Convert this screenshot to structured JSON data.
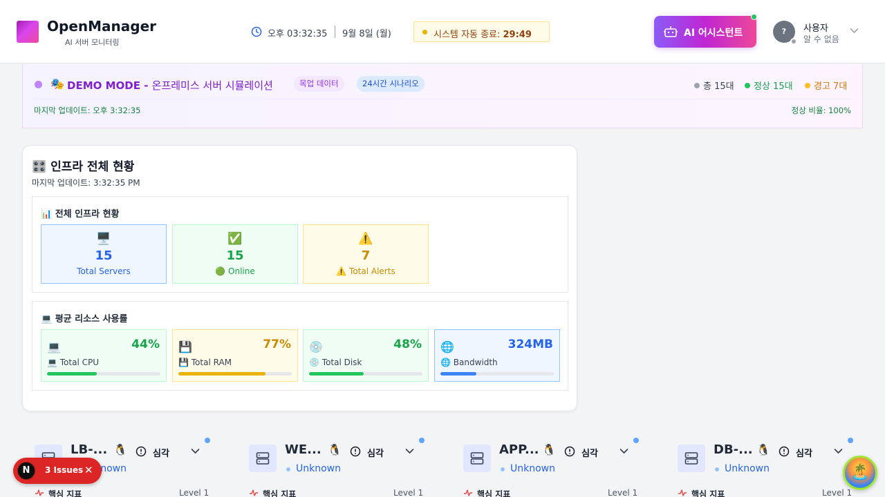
{
  "header": {
    "title": "OpenManager",
    "subtitle": "AI 서버 모니터링",
    "time": "오후 03:32:35",
    "date": "9월 8일 (월)",
    "shutdown_label": "시스템 자동 종료:",
    "shutdown_timer": "29:49",
    "ai_button_label": "AI 어시스턴트",
    "user_avatar_initial": "?",
    "user_name": "사용자",
    "user_status": "알 수 없음"
  },
  "demo_banner": {
    "emoji": "🎭",
    "title_bold": "DEMO MODE -",
    "title_rest": "온프레미스 서버 시뮬레이션",
    "tag_mock": "목업 데이터",
    "tag_scenario": "24시간 시나리오",
    "total": "총 15대",
    "normal": "정상 15대",
    "warning": "경고 7대",
    "last_updated": "마지막 업데이트: 오후 3:32:35",
    "normal_ratio": "정상 비율: 100%"
  },
  "infra": {
    "title": "🎛️ 인프라 전체 현황",
    "last_updated": "마지막 업데이트: 3:32:35 PM",
    "overview": {
      "title": "📊 전체 인프라 현황",
      "stats": [
        {
          "icon": "🖥️",
          "value": "15",
          "label": "Total Servers",
          "color": "#2563eb",
          "bg": "#eff6ff",
          "border": "#93c5fd"
        },
        {
          "icon": "✅",
          "value": "15",
          "label": "🟢 Online",
          "color": "#16a34a",
          "bg": "#f0fdf4",
          "border": "#bbf7d0"
        },
        {
          "icon": "⚠️",
          "value": "7",
          "label": "⚠️ Total Alerts",
          "color": "#ca8a04",
          "bg": "#fefce8",
          "border": "#fde68a"
        }
      ]
    },
    "resources": {
      "title": "💻 평균 리소스 사용률",
      "items": [
        {
          "icon": "💻",
          "value": "44%",
          "label": "💻 Total CPU",
          "percent": 44,
          "color": "#16a34a",
          "bar": "#22c55e",
          "bg": "#f0fdf4",
          "border": "#bbf7d0"
        },
        {
          "icon": "💾",
          "value": "77%",
          "label": "💾 Total RAM",
          "percent": 77,
          "color": "#ca8a04",
          "bar": "#eab308",
          "bg": "#fefce8",
          "border": "#fde68a"
        },
        {
          "icon": "💿",
          "value": "48%",
          "label": "💿 Total Disk",
          "percent": 48,
          "color": "#16a34a",
          "bar": "#22c55e",
          "bg": "#f0fdf4",
          "border": "#bbf7d0"
        },
        {
          "icon": "🌐",
          "value": "324MB",
          "label": "🌐 Bandwidth",
          "percent": 32,
          "color": "#2563eb",
          "bar": "#3b82f6",
          "bg": "#eff6ff",
          "border": "#93c5fd"
        }
      ]
    }
  },
  "servers": [
    {
      "name": "LB-...",
      "os": "🐧",
      "severity": "심각",
      "location": "Unknown",
      "metric_label": "핵심 지표",
      "level": "Level 1"
    },
    {
      "name": "WE...",
      "os": "🐧",
      "severity": "심각",
      "location": "Unknown",
      "metric_label": "핵심 지표",
      "level": "Level 1"
    },
    {
      "name": "APP...",
      "os": "🐧",
      "severity": "심각",
      "location": "Unknown",
      "metric_label": "핵심 지표",
      "level": "Level 1"
    },
    {
      "name": "DB-...",
      "os": "🐧",
      "severity": "심각",
      "location": "Unknown",
      "metric_label": "핵심 지표",
      "level": "Level 1"
    }
  ],
  "issues_pill": {
    "initial": "N",
    "label": "3 Issues",
    "close": "✕"
  },
  "corner_badge": "🏝️"
}
